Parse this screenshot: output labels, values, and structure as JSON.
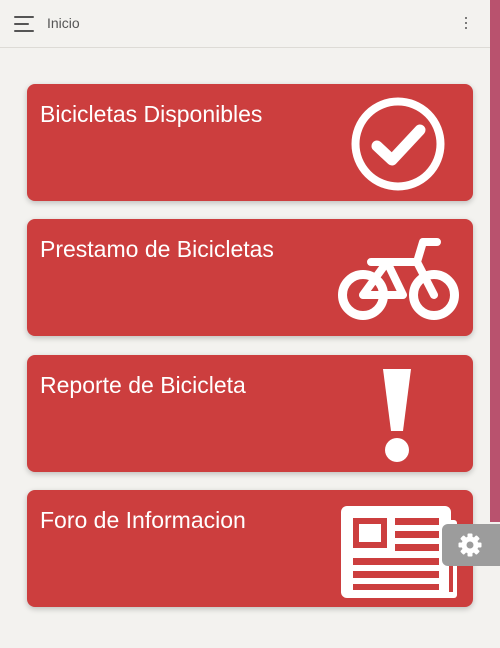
{
  "header": {
    "title": "Inicio",
    "menu_icon": "hamburger-menu-icon",
    "overflow_icon": "more-vertical-icon"
  },
  "cards": [
    {
      "label": "Bicicletas Disponibles",
      "icon": "check-circle-icon"
    },
    {
      "label": "Prestamo de Bicicletas",
      "icon": "bicycle-icon"
    },
    {
      "label": "Reporte de Bicicleta",
      "icon": "exclamation-icon"
    },
    {
      "label": "Foro de Informacion",
      "icon": "newspaper-icon"
    }
  ],
  "settings": {
    "icon": "gear-icon"
  },
  "colors": {
    "card_background": "#cc3e3e",
    "page_background": "#f3f2ef",
    "side_accent": "#b9526e",
    "settings_tab": "#9c9c9c"
  }
}
